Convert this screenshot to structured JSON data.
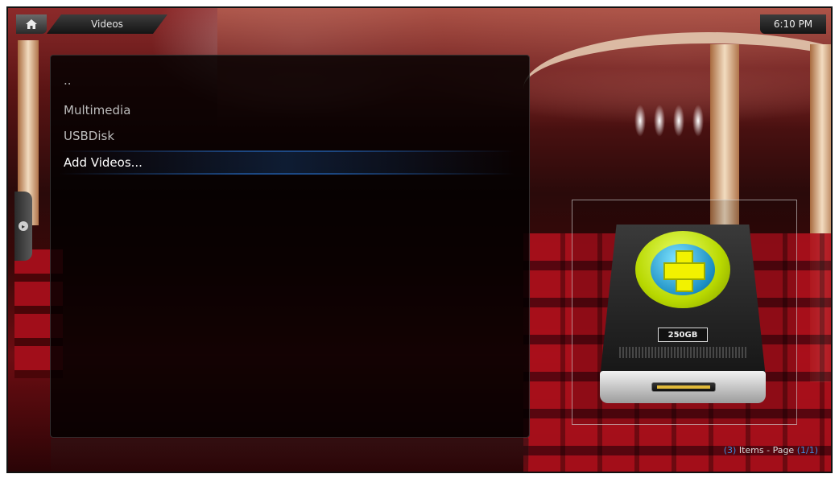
{
  "header": {
    "home_icon": "home-icon",
    "section_title": "Videos",
    "clock": "6:10 PM"
  },
  "list": {
    "items": [
      {
        "label": "..",
        "focused": false
      },
      {
        "label": "Multimedia",
        "focused": false
      },
      {
        "label": "USBDisk",
        "focused": false
      },
      {
        "label": "Add Videos...",
        "focused": true
      }
    ]
  },
  "thumbnail": {
    "icon": "add-drive-icon",
    "capacity_label": "250GB"
  },
  "footer": {
    "count_open": "(",
    "count": "3",
    "count_close": ")",
    "items_text": " Items - Page ",
    "page_open": "(",
    "page": "1/1",
    "page_close": ")"
  },
  "colors": {
    "accent": "#3c8bdc",
    "focus_highlight": "#286ec8",
    "drive_plus_green": "#b8d800",
    "drive_plus_blue": "#1c8fc4"
  }
}
